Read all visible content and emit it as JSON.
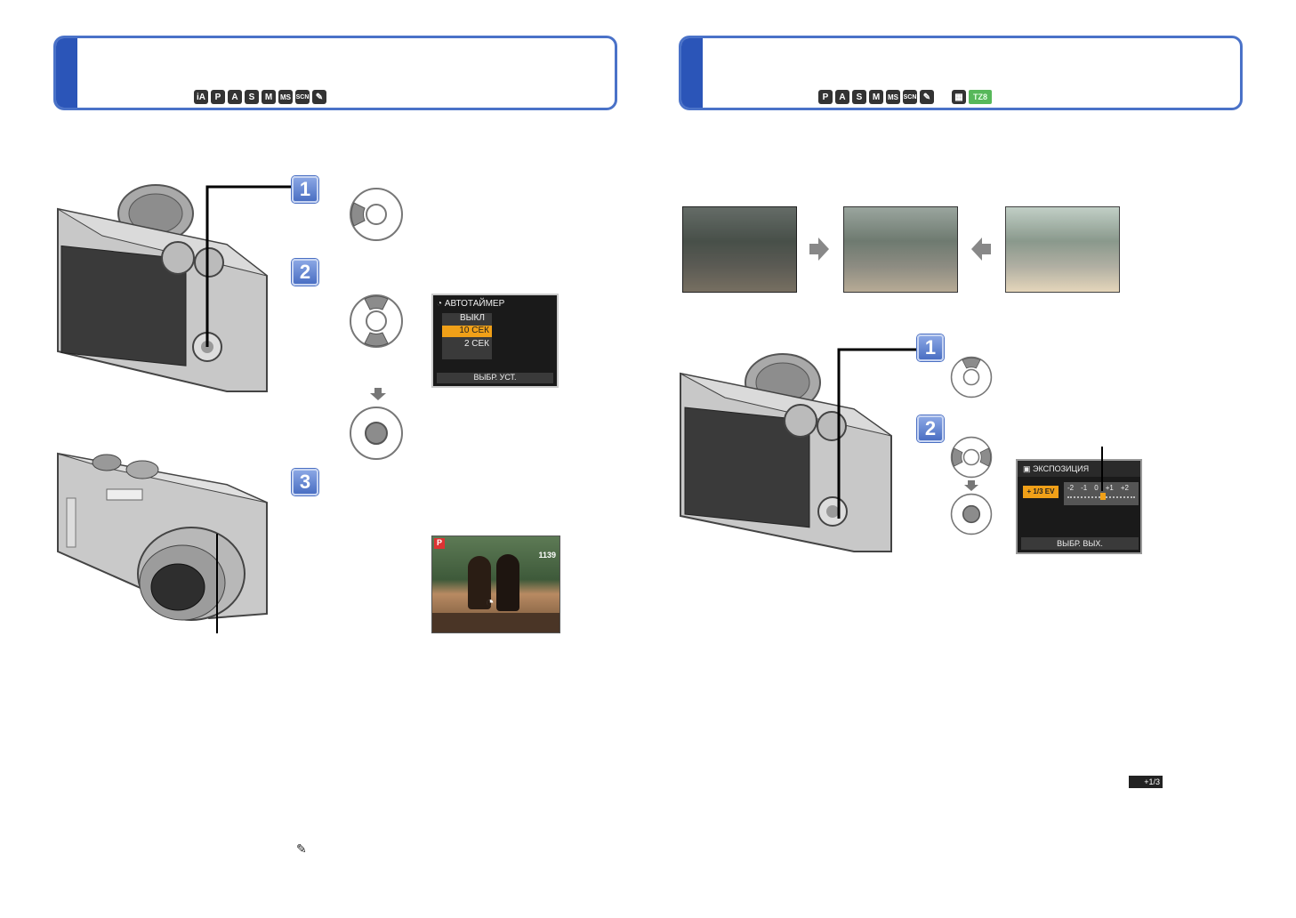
{
  "left_header": {
    "modes": [
      "iA",
      "P",
      "A",
      "S",
      "M",
      "MS",
      "SCN",
      "✎"
    ]
  },
  "right_header": {
    "modes": [
      "P",
      "A",
      "S",
      "M",
      "MS",
      "SCN",
      "✎",
      "▦",
      "TZ8"
    ]
  },
  "steps": {
    "left": [
      "1",
      "2",
      "3"
    ],
    "right": [
      "1",
      "2"
    ]
  },
  "timer_screen": {
    "title": "АВТОТАЙМЕР",
    "items": [
      "ВЫКЛ",
      "10 СЕК",
      "2 СЕК"
    ],
    "selected": "10 СЕК",
    "footer": "ВЫБР. УСТ."
  },
  "preview_screen": {
    "mode": "P",
    "count": "1139"
  },
  "exposure_screen": {
    "title": "ЭКСПОЗИЦИЯ",
    "value": "+ 1/3 EV",
    "scale": [
      "-2",
      "-1",
      "0",
      "+1",
      "+2"
    ],
    "footer": "ВЫБР. ВЫХ."
  },
  "bottom_icons": {
    "exposure_badge": "+1/3",
    "clip_icon": "✎"
  },
  "colors": {
    "header_border": "#4a72c8",
    "header_tab": "#2b55b8",
    "highlight": "#f0a018"
  }
}
